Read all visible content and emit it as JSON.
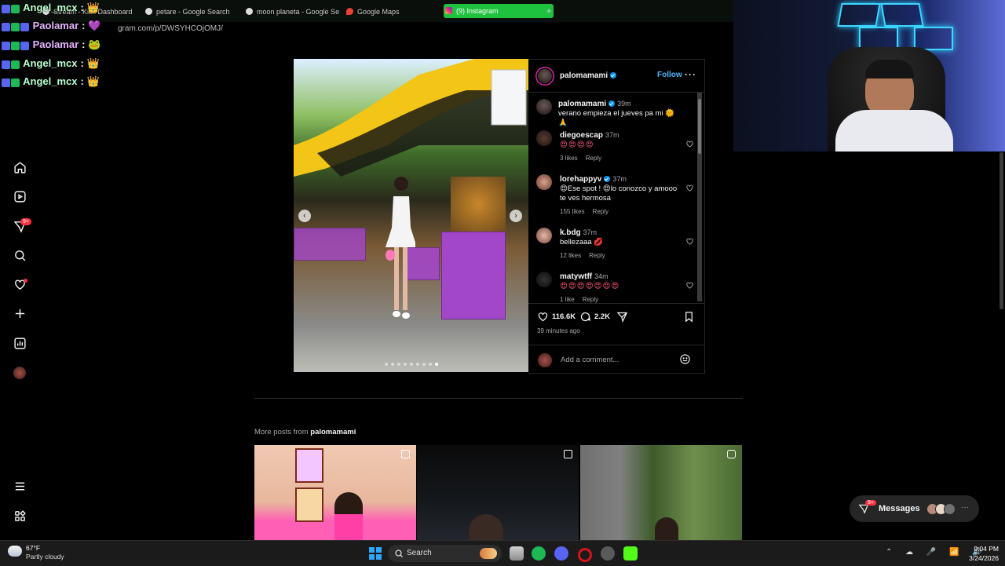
{
  "browser": {
    "tabs": [
      {
        "label": "Stream - Kick Dashboard"
      },
      {
        "label": "petare - Google Search"
      },
      {
        "label": "moon planeta - Google Se"
      },
      {
        "label": "Google Maps"
      },
      {
        "label": "(9) Instagram",
        "active": true
      }
    ],
    "new_tab": "+",
    "url": "gram.com/p/DWSYHCOjOMJ/"
  },
  "chat": [
    {
      "user": "Angel_mcx",
      "msg": ": 👑"
    },
    {
      "user": "Paolamar",
      "msg": ": 💜"
    },
    {
      "user": "Paolamar",
      "msg": ": 🐸"
    },
    {
      "user": "Angel_mcx",
      "msg": ": 👑"
    },
    {
      "user": "Angel_mcx",
      "msg": ": 👑"
    }
  ],
  "nav": {
    "notification_count": "9+"
  },
  "post": {
    "author": "palomamami",
    "follow_label": "Follow",
    "more_label": "···",
    "caption": {
      "user": "palomamami",
      "time": "39m",
      "text": "verano empieza el jueves pa mi 🌞🙏"
    },
    "comments": [
      {
        "user": "diegoescap",
        "time": "37m",
        "text": "😍😍😍😍",
        "likes": "3 likes",
        "reply": "Reply"
      },
      {
        "user": "lorehappyv",
        "time": "37m",
        "text": "😍Ese spot ! 😍lo conozco y amooo te ves hermosa",
        "likes": "155 likes",
        "reply": "Reply",
        "verified": true
      },
      {
        "user": "k.bdg",
        "time": "37m",
        "text": "bellezaaa 💋",
        "likes": "12 likes",
        "reply": "Reply"
      },
      {
        "user": "matywtff",
        "time": "34m",
        "text": "😍😍😍😍😍😍😍",
        "likes": "1 like",
        "reply": "Reply"
      }
    ],
    "like_count": "116.6K",
    "comment_count": "2.2K",
    "posted_ago": "39 minutes ago",
    "add_comment_placeholder": "Add a comment...",
    "carousel_prev": "‹",
    "carousel_next": "›"
  },
  "more_posts": {
    "prefix": "More posts from ",
    "user": "palomamami"
  },
  "messages": {
    "label": "Messages",
    "badge": "9+"
  },
  "taskbar": {
    "weather_temp": "67°F",
    "weather_desc": "Partly cloudy",
    "search_label": "Search",
    "time": "9:04 PM",
    "date": "3/24/2026"
  },
  "colors": {
    "accent": "#0095f6",
    "follow": "#4cb5f9",
    "active_tab": "#1ec23e",
    "badge": "#ff3040"
  }
}
